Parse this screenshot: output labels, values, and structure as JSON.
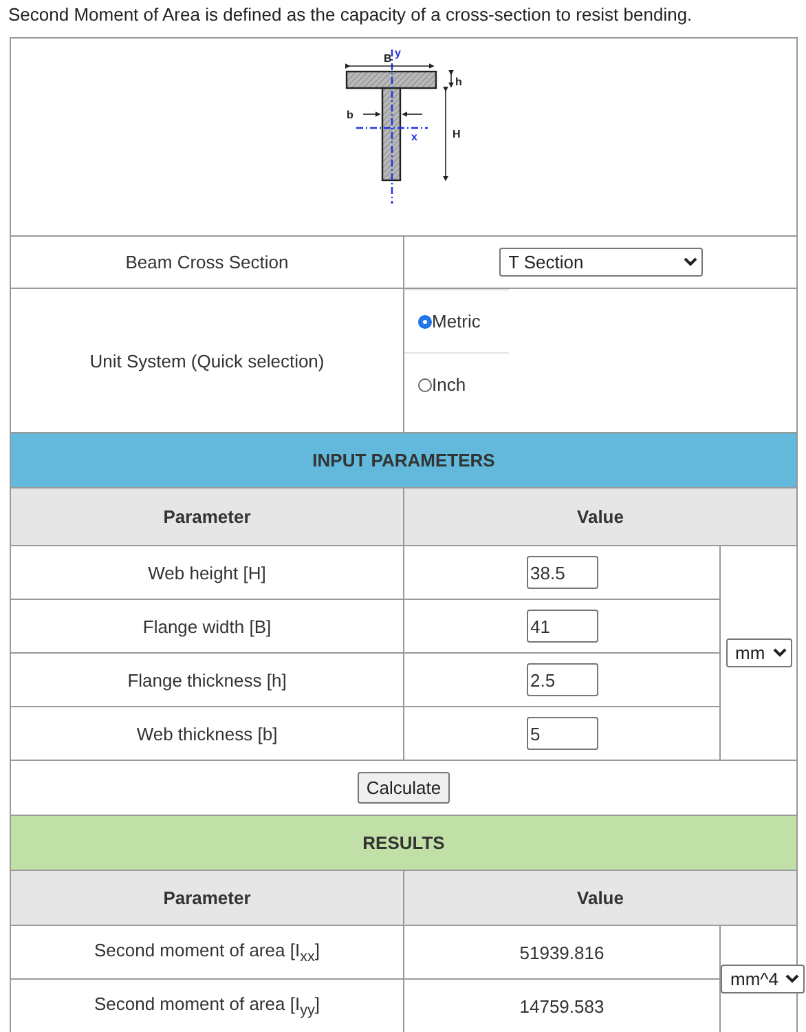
{
  "intro": "Second Moment of Area is defined as the capacity of a cross-section to resist bending.",
  "diagram": {
    "labels": [
      "B",
      "y",
      "h",
      "b",
      "x",
      "H"
    ]
  },
  "cross_section": {
    "label": "Beam Cross Section",
    "value": "T Section"
  },
  "unit_system": {
    "label": "Unit System (Quick selection)",
    "options": [
      {
        "label": "Metric",
        "selected": true
      },
      {
        "label": "Inch",
        "selected": false
      }
    ]
  },
  "input_section": {
    "title": "INPUT PARAMETERS",
    "columns": [
      "Parameter",
      "Value"
    ],
    "unit": "mm",
    "rows": [
      {
        "name": "Web height [H]",
        "value": "38.5"
      },
      {
        "name": "Flange width [B]",
        "value": "41"
      },
      {
        "name": "Flange thickness [h]",
        "value": "2.5"
      },
      {
        "name": "Web thickness [b]",
        "value": "5"
      }
    ]
  },
  "calculate_button": "Calculate",
  "results_section": {
    "title": "RESULTS",
    "columns": [
      "Parameter",
      "Value"
    ],
    "unit": "mm^4",
    "rows": [
      {
        "name": "Second moment of area [I$_{xx}$]",
        "value": "51939.816"
      },
      {
        "name": "Second moment of area [I$_{yy}$]",
        "value": "14759.583"
      }
    ]
  }
}
